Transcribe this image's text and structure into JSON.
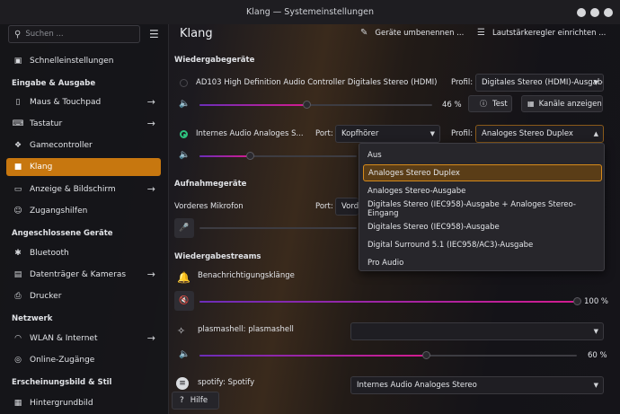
{
  "window": {
    "title": "Klang — Systemeinstellungen"
  },
  "sidebar": {
    "search_placeholder": "Suchen ...",
    "items": [
      {
        "label": "Schnelleinstellungen",
        "icon": "quick-settings-icon"
      },
      {
        "section": "Eingabe & Ausgabe"
      },
      {
        "label": "Maus & Touchpad",
        "icon": "mouse-icon",
        "arrow": true
      },
      {
        "label": "Tastatur",
        "icon": "keyboard-icon",
        "arrow": true
      },
      {
        "label": "Gamecontroller",
        "icon": "gamepad-icon"
      },
      {
        "label": "Klang",
        "icon": "speaker-icon",
        "active": true
      },
      {
        "label": "Anzeige & Bildschirm",
        "icon": "display-icon",
        "arrow": true
      },
      {
        "label": "Zugangshilfen",
        "icon": "accessibility-icon"
      },
      {
        "section": "Angeschlossene Geräte"
      },
      {
        "label": "Bluetooth",
        "icon": "bluetooth-icon"
      },
      {
        "label": "Datenträger & Kameras",
        "icon": "drive-icon",
        "arrow": true
      },
      {
        "label": "Drucker",
        "icon": "printer-icon"
      },
      {
        "section": "Netzwerk"
      },
      {
        "label": "WLAN & Internet",
        "icon": "wifi-icon",
        "arrow": true
      },
      {
        "label": "Online-Zugänge",
        "icon": "online-accounts-icon"
      },
      {
        "section": "Erscheinungsbild & Stil"
      },
      {
        "label": "Hintergrundbild",
        "icon": "wallpaper-icon"
      }
    ]
  },
  "header": {
    "title": "Klang",
    "rename_button": "Geräte umbenennen ...",
    "volume_button": "Lautstärkeregler einrichten ..."
  },
  "playback": {
    "heading": "Wiedergabegeräte",
    "device1": {
      "name": "AD103 High Definition Audio Controller Digitales Stereo (HDMI)",
      "profile_label": "Profil:",
      "profile": "Digitales Stereo (HDMI)-Ausgabe",
      "volume": "46 %",
      "volume_value": 0.46,
      "test_button": "Test",
      "channels_button": "Kanäle anzeigen"
    },
    "device2": {
      "name": "Internes Audio Analoges S...",
      "port_label": "Port:",
      "port": "Kopfhörer",
      "profile_label": "Profil:",
      "profile": "Analoges Stereo Duplex",
      "volume_value": 0.32
    }
  },
  "recording": {
    "heading": "Aufnahmegeräte",
    "device": {
      "name": "Vorderes Mikrofon",
      "port_label": "Port:",
      "port": "Vorde"
    }
  },
  "streams": {
    "heading": "Wiedergabestreams",
    "items": [
      {
        "name": "Benachrichtigungsklänge",
        "volume": "100 %",
        "volume_value": 1.0
      },
      {
        "name": "plasmashell: plasmashell",
        "volume": "60 %",
        "volume_value": 0.6,
        "output": ""
      },
      {
        "name": "spotify: Spotify",
        "output": "Internes Audio Analoges Stereo"
      }
    ]
  },
  "dropdown": {
    "options": [
      "Aus",
      "Analoges Stereo Duplex",
      "Analoges Stereo-Ausgabe",
      "Digitales Stereo (IEC958)-Ausgabe + Analoges Stereo-Eingang",
      "Digitales Stereo (IEC958)-Ausgabe",
      "Digital Surround 5.1 (IEC958/AC3)-Ausgabe",
      "Pro Audio"
    ],
    "selected": "Analoges Stereo Duplex"
  },
  "footer": {
    "help_button": "Hilfe"
  }
}
